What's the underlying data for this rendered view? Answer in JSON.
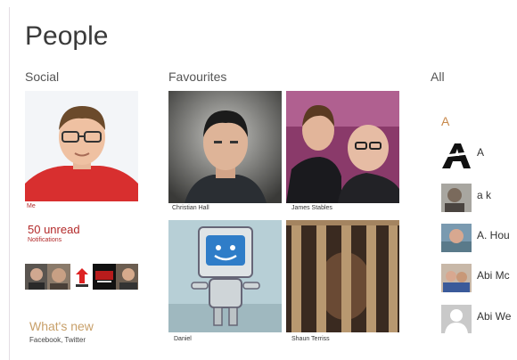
{
  "page": {
    "title": "People"
  },
  "sections": {
    "social": "Social",
    "favourites": "Favourites",
    "all": "All"
  },
  "social": {
    "me_label": "Me",
    "unread_count": "50 unread",
    "unread_sub": "Notifications",
    "whats_new_title": "What's new",
    "whats_new_sub": "Facebook, Twitter"
  },
  "favourites": [
    {
      "name": "Christian Hall"
    },
    {
      "name": "James Stables"
    },
    {
      "name": "Daniel"
    },
    {
      "name": "Shaun Terriss"
    }
  ],
  "all_list": {
    "group_letter": "A",
    "contacts": [
      {
        "name": "A",
        "avatar": "black-A-logo"
      },
      {
        "name": "a k",
        "avatar": "photo"
      },
      {
        "name": "A. Hou",
        "avatar": "photo"
      },
      {
        "name": "Abi Mc",
        "avatar": "photo"
      },
      {
        "name": "Abi We",
        "avatar": "placeholder-person-icon"
      }
    ]
  },
  "colors": {
    "accent_red": "#b32a2a",
    "letter_orange": "#c8884a",
    "whats_new": "#c8a06a"
  }
}
